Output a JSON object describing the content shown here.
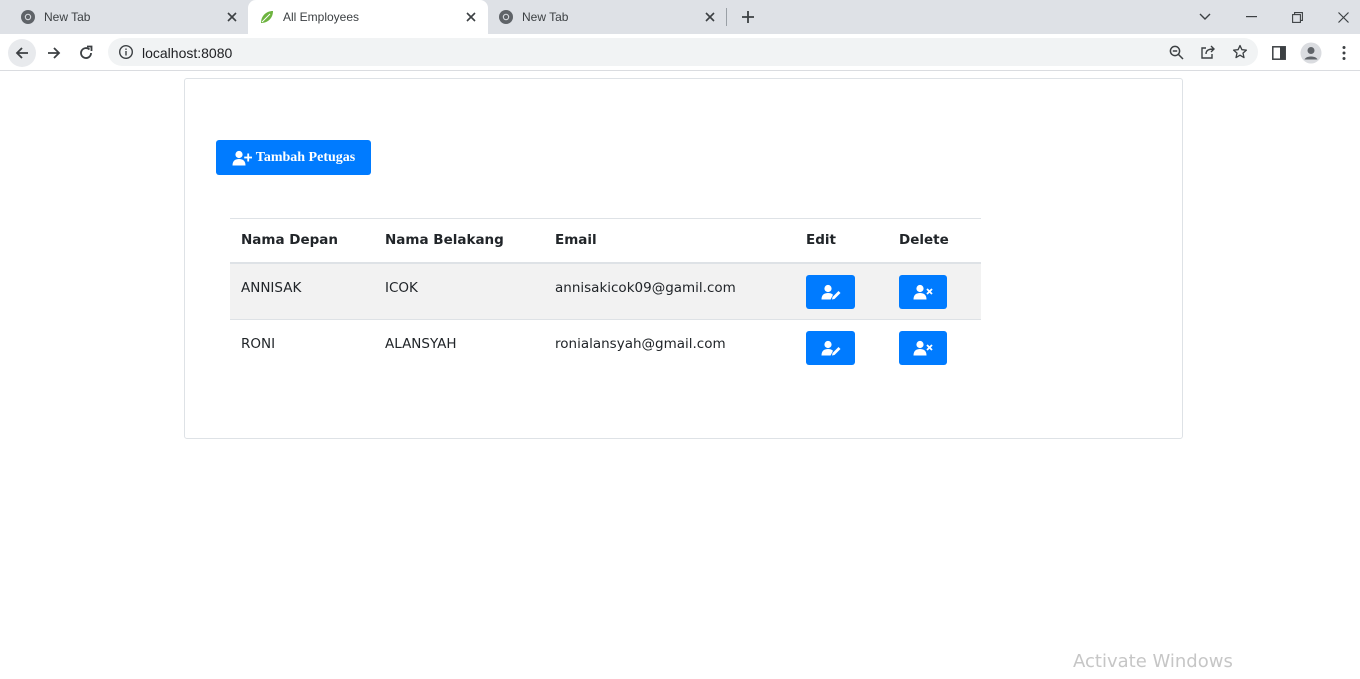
{
  "browser": {
    "tabs": [
      {
        "title": "New Tab",
        "active": false,
        "icon": "chrome-icon"
      },
      {
        "title": "All Employees",
        "active": true,
        "icon": "spring-leaf-icon"
      },
      {
        "title": "New Tab",
        "active": false,
        "icon": "chrome-icon"
      }
    ],
    "url": "localhost:8080"
  },
  "page": {
    "add_button_label": "Tambah Petugas",
    "table": {
      "headers": [
        "Nama Depan",
        "Nama Belakang",
        "Email",
        "Edit",
        "Delete"
      ],
      "rows": [
        {
          "first_name": "ANNISAK",
          "last_name": "ICOK",
          "email": "annisakicok09@gamil.com"
        },
        {
          "first_name": "RONI",
          "last_name": "ALANSYAH",
          "email": "ronialansyah@gmail.com"
        }
      ]
    }
  },
  "overlay": {
    "watermark": "Activate Windows"
  },
  "colors": {
    "primary": "#007bff",
    "tabstrip": "#dee1e6",
    "stripe": "#f2f2f2"
  }
}
